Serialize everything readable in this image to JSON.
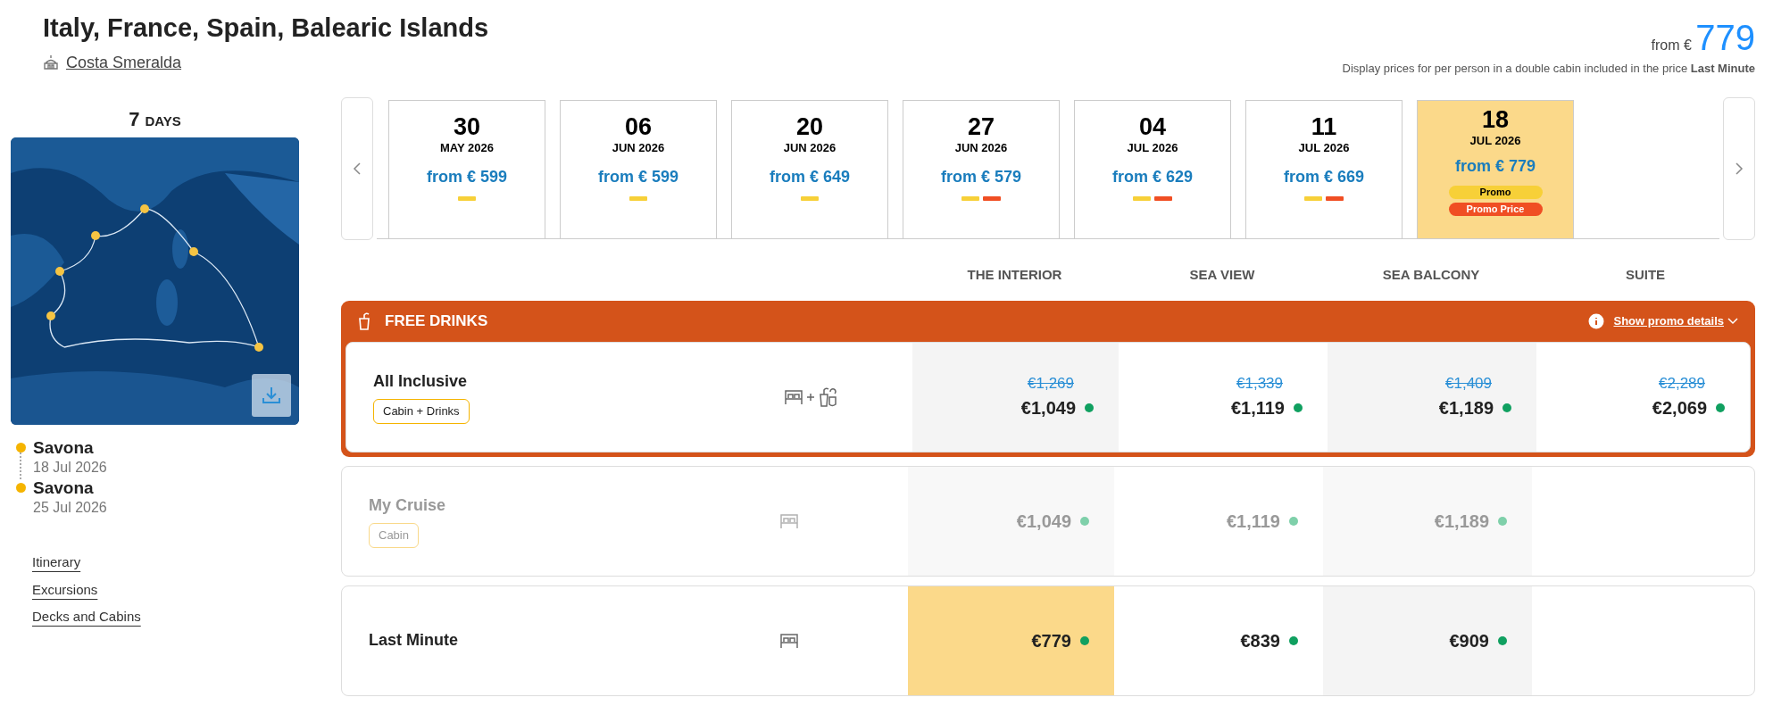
{
  "trip": {
    "title": "Italy, France, Spain, Balearic Islands",
    "ship": "Costa Smeralda",
    "duration_number": "7",
    "duration_unit": "DAYS"
  },
  "price_summary": {
    "prefix": "from €",
    "amount": "779",
    "note": "Display prices for per person in a double cabin included in the price **Last Minute**"
  },
  "itinerary": {
    "stops": [
      {
        "port": "Savona",
        "date": "18 Jul 2026"
      },
      {
        "port": "Savona",
        "date": "25 Jul 2026"
      }
    ],
    "links": [
      "Itinerary",
      "Excursions",
      "Decks and Cabins"
    ]
  },
  "dates": [
    {
      "day": "30",
      "month": "MAY 2026",
      "price": "from € 599",
      "selected": false,
      "tags": [
        {
          "color": "#f7d038"
        }
      ]
    },
    {
      "day": "06",
      "month": "JUN 2026",
      "price": "from € 599",
      "selected": false,
      "tags": [
        {
          "color": "#f7d038"
        }
      ]
    },
    {
      "day": "20",
      "month": "JUN 2026",
      "price": "from € 649",
      "selected": false,
      "tags": [
        {
          "color": "#f7d038"
        }
      ]
    },
    {
      "day": "27",
      "month": "JUN 2026",
      "price": "from € 579",
      "selected": false,
      "tags": [
        {
          "color": "#f7d038"
        },
        {
          "color": "#f04e23"
        }
      ]
    },
    {
      "day": "04",
      "month": "JUL 2026",
      "price": "from € 629",
      "selected": false,
      "tags": [
        {
          "color": "#f7d038"
        },
        {
          "color": "#f04e23"
        }
      ]
    },
    {
      "day": "11",
      "month": "JUL 2026",
      "price": "from € 669",
      "selected": false,
      "tags": [
        {
          "color": "#f7d038"
        },
        {
          "color": "#f04e23"
        }
      ]
    },
    {
      "day": "18",
      "month": "JUL 2026",
      "price": "from € 779",
      "selected": true,
      "tags": [
        {
          "label": "Promo",
          "color": "#f7d038"
        },
        {
          "label": "Promo Price",
          "color": "#f04e23"
        }
      ]
    }
  ],
  "cabin_columns": [
    "THE INTERIOR",
    "SEA VIEW",
    "SEA BALCONY",
    "SUITE"
  ],
  "promo": {
    "label": "FREE DRINKS",
    "details_link": "Show promo details",
    "expanded": false
  },
  "offers": [
    {
      "name": "All Inclusive",
      "tag": "Cabin + Drinks",
      "promo": true,
      "disabled": false,
      "includes": [
        {
          "kind": "cabin"
        },
        {
          "kind": "drinks"
        }
      ],
      "prices": [
        {
          "old": "€1,269",
          "price": "€1,049",
          "selected": false
        },
        {
          "old": "€1,339",
          "price": "€1,119",
          "selected": false
        },
        {
          "old": "€1,409",
          "price": "€1,189",
          "selected": false
        },
        {
          "old": "€2,289",
          "price": "€2,069",
          "selected": false
        }
      ]
    },
    {
      "name": "My Cruise",
      "tag": "Cabin",
      "promo": false,
      "disabled": true,
      "includes": [
        {
          "kind": "cabin"
        }
      ],
      "prices": [
        {
          "price": "€1,049",
          "selected": false
        },
        {
          "price": "€1,119",
          "selected": false
        },
        {
          "price": "€1,189",
          "selected": false
        }
      ]
    },
    {
      "name": "Last Minute",
      "promo": false,
      "disabled": false,
      "includes": [
        {
          "kind": "cabin"
        }
      ],
      "prices": [
        {
          "price": "€779",
          "selected": true
        },
        {
          "price": "€839",
          "selected": false
        },
        {
          "price": "€909",
          "selected": false
        }
      ]
    }
  ]
}
